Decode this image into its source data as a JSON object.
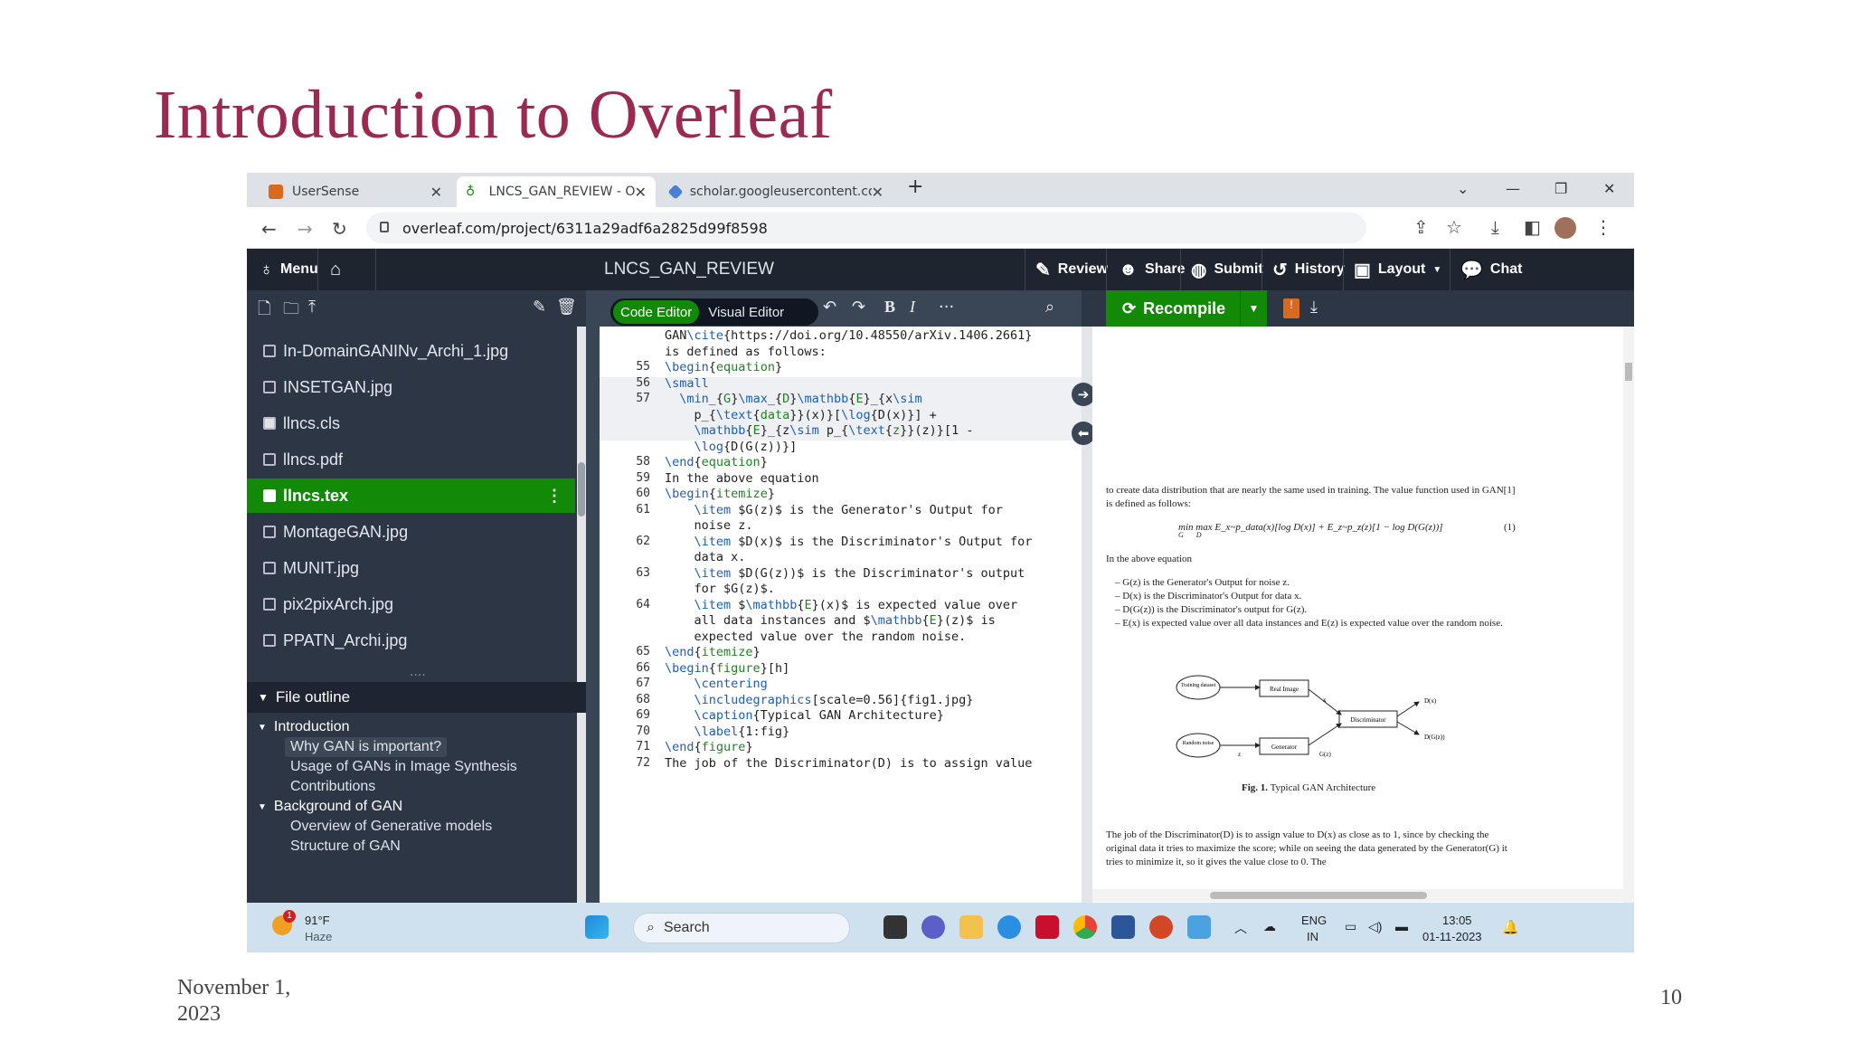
{
  "slide": {
    "title": "Introduction to Overleaf",
    "date": "November 1, 2023",
    "page_number": "10"
  },
  "browser": {
    "tabs": [
      {
        "label": "UserSense",
        "icon": "usersense-icon"
      },
      {
        "label": "LNCS_GAN_REVIEW - Online La",
        "icon": "overleaf-icon"
      },
      {
        "label": "scholar.googleusercontent.com/",
        "icon": "scholar-icon"
      }
    ],
    "new_tab": "+",
    "url": "overleaf.com/project/6311a29adf6a2825d99f8598"
  },
  "overleaf": {
    "menu_label": "Menu",
    "project_name": "LNCS_GAN_REVIEW",
    "toolbar": {
      "review": "Review",
      "share": "Share",
      "submit": "Submit",
      "history": "History",
      "layout": "Layout",
      "chat": "Chat"
    },
    "editor_toggle": {
      "code": "Code Editor",
      "visual": "Visual Editor"
    },
    "format": {
      "bold": "B",
      "italic": "I",
      "more": "···"
    },
    "recompile": "Recompile",
    "files": [
      {
        "name": "In-DomainGANINv_Archi_1.jpg",
        "type": "image"
      },
      {
        "name": "INSETGAN.jpg",
        "type": "image"
      },
      {
        "name": "llncs.cls",
        "type": "file"
      },
      {
        "name": "llncs.pdf",
        "type": "image"
      },
      {
        "name": "llncs.tex",
        "type": "file",
        "selected": true
      },
      {
        "name": "MontageGAN.jpg",
        "type": "image"
      },
      {
        "name": "MUNIT.jpg",
        "type": "image"
      },
      {
        "name": "pix2pixArch.jpg",
        "type": "image"
      },
      {
        "name": "PPATN_Archi.jpg",
        "type": "image"
      }
    ],
    "file_outline": {
      "title": "File outline",
      "items": [
        {
          "label": "Introduction",
          "level": 0
        },
        {
          "label": "Why GAN is important?",
          "level": 1,
          "highlighted": true
        },
        {
          "label": "Usage of GANs in Image Synthesis",
          "level": 1
        },
        {
          "label": "Contributions",
          "level": 1
        },
        {
          "label": "Background of GAN",
          "level": 0
        },
        {
          "label": "Overview of Generative models",
          "level": 1
        },
        {
          "label": "Structure of GAN",
          "level": 1
        }
      ]
    },
    "code_lines": [
      {
        "n": "",
        "text": "GAN\\cite{https://doi.org/10.48550/arXiv.1406.2661}"
      },
      {
        "n": "",
        "text": "is defined as follows:"
      },
      {
        "n": "55",
        "text": "\\begin{equation}"
      },
      {
        "n": "56",
        "text": "\\small"
      },
      {
        "n": "57",
        "text": "  \\min_{G}\\max_{D}\\mathbb{E}_{x\\sim"
      },
      {
        "n": "",
        "text": "    p_{\\text{data}}(x)}[\\log{D(x)}] +"
      },
      {
        "n": "",
        "text": "    \\mathbb{E}_{z\\sim p_{\\text{z}}(z)}[1 -"
      },
      {
        "n": "",
        "text": "    \\log{D(G(z))}]"
      },
      {
        "n": "58",
        "text": "\\end{equation}"
      },
      {
        "n": "59",
        "text": "In the above equation"
      },
      {
        "n": "60",
        "text": "\\begin{itemize}"
      },
      {
        "n": "61",
        "text": "    \\item $G(z)$ is the Generator's Output for"
      },
      {
        "n": "",
        "text": "    noise z."
      },
      {
        "n": "62",
        "text": "    \\item $D(x)$ is the Discriminator's Output for"
      },
      {
        "n": "",
        "text": "    data x."
      },
      {
        "n": "63",
        "text": "    \\item $D(G(z))$ is the Discriminator's output"
      },
      {
        "n": "",
        "text": "    for $G(z)$."
      },
      {
        "n": "64",
        "text": "    \\item $\\mathbb{E}(x)$ is expected value over"
      },
      {
        "n": "",
        "text": "    all data instances and $\\mathbb{E}(z)$ is"
      },
      {
        "n": "",
        "text": "    expected value over the random noise."
      },
      {
        "n": "65",
        "text": "\\end{itemize}"
      },
      {
        "n": "66",
        "text": "\\begin{figure}[h]"
      },
      {
        "n": "67",
        "text": "    \\centering"
      },
      {
        "n": "68",
        "text": "    \\includegraphics[scale=0.56]{fig1.jpg}"
      },
      {
        "n": "69",
        "text": "    \\caption{Typical GAN Architecture}"
      },
      {
        "n": "70",
        "text": "    \\label{1:fig}"
      },
      {
        "n": "71",
        "text": "\\end{figure}"
      },
      {
        "n": "72",
        "text": "The job of the Discriminator(D) is to assign value"
      }
    ],
    "pdf": {
      "para1": "to create data distribution that are nearly the same used in training. The value function used in GAN[1] is defined as follows:",
      "equation": "min max E_x~p_data(x)[log D(x)] + E_z~p_z(z)[1 − log D(G(z))]",
      "eq_min": "G",
      "eq_max": "D",
      "eq_num": "(1)",
      "para2": "In the above equation",
      "bullets": [
        "G(z) is the Generator's Output for noise z.",
        "D(x) is the Discriminator's Output for data x.",
        "D(G(z)) is the Discriminator's output for G(z).",
        "E(x) is expected value over all data instances and E(z) is expected value over the random noise."
      ],
      "diagram": {
        "training": "Training dataset",
        "real": "Real Image",
        "x": "x",
        "disc": "Discriminator",
        "dx": "D(x)",
        "dgz": "D(G(z))",
        "noise": "Random noise",
        "z": "z",
        "gen": "Generator",
        "gz": "G(z)"
      },
      "caption_bold": "Fig. 1.",
      "caption": "Typical GAN Architecture",
      "para3": "The job of the Discriminator(D) is to assign value to D(x) as close as to 1, since by checking the original data it tries to maximize the score; while on seeing the data generated by the Generator(G) it tries to minimize it, so it gives the value close to 0. The"
    }
  },
  "taskbar": {
    "weather_temp": "91°F",
    "weather_desc": "Haze",
    "weather_badge": "1",
    "search": "Search",
    "lang": "ENG",
    "region": "IN",
    "time": "13:05",
    "date": "01-11-2023"
  },
  "colors": {
    "title": "#9b2a52",
    "overleaf_green": "#138a07",
    "overleaf_dark": "#1e2530"
  }
}
